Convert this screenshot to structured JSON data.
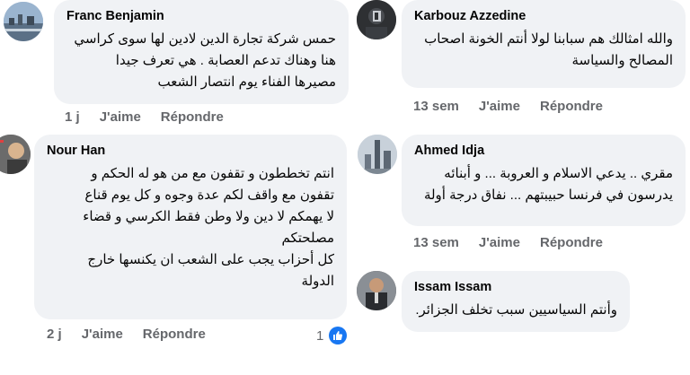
{
  "comments": [
    {
      "author": "Franc Benjamin",
      "text": "حمس شركة تجارة الدين لادين لها سوى كراسي\nهنا وهناك تدعم العصابة . هي تعرف جيدا\nمصيرها الفناء يوم انتصار الشعب",
      "time": "1 j",
      "like_label": "J'aime",
      "reply_label": "Répondre"
    },
    {
      "author": "Karbouz Azzedine",
      "text": "والله امثالك هم سبابنا لولا أنتم الخونة اصحاب\nالمصالح والسياسة",
      "time": "13 sem",
      "like_label": "J'aime",
      "reply_label": "Répondre"
    },
    {
      "author": "Nour Han",
      "text": "انتم تخططون و تقفون مع من هو له الحكم و\nتقفون مع واقف لكم عدة وجوه و كل يوم قناع\nلا يهمكم لا دين ولا وطن فقط الكرسي و قضاء\nمصلحتكم\nكل أحزاب يجب على الشعب ان يكنسها خارج\nالدولة",
      "time": "2 j",
      "like_label": "J'aime",
      "reply_label": "Répondre",
      "reaction_count": "1"
    },
    {
      "author": "Ahmed Idja",
      "text": "مقري .. يدعي الاسلام و العروبة ... و أبنائه\nيدرسون في فرنسا حبيبتهم ... نفاق درجة أولة",
      "time": "13 sem",
      "like_label": "J'aime",
      "reply_label": "Répondre"
    },
    {
      "author": "Issam Issam",
      "text": "وأنتم السياسيين سبب تخلف الجزائر.",
      "time": "",
      "like_label": "",
      "reply_label": ""
    }
  ],
  "colors": {
    "bubble": "#f0f2f5",
    "meta": "#65676b",
    "like_blue": "#1877f2"
  }
}
